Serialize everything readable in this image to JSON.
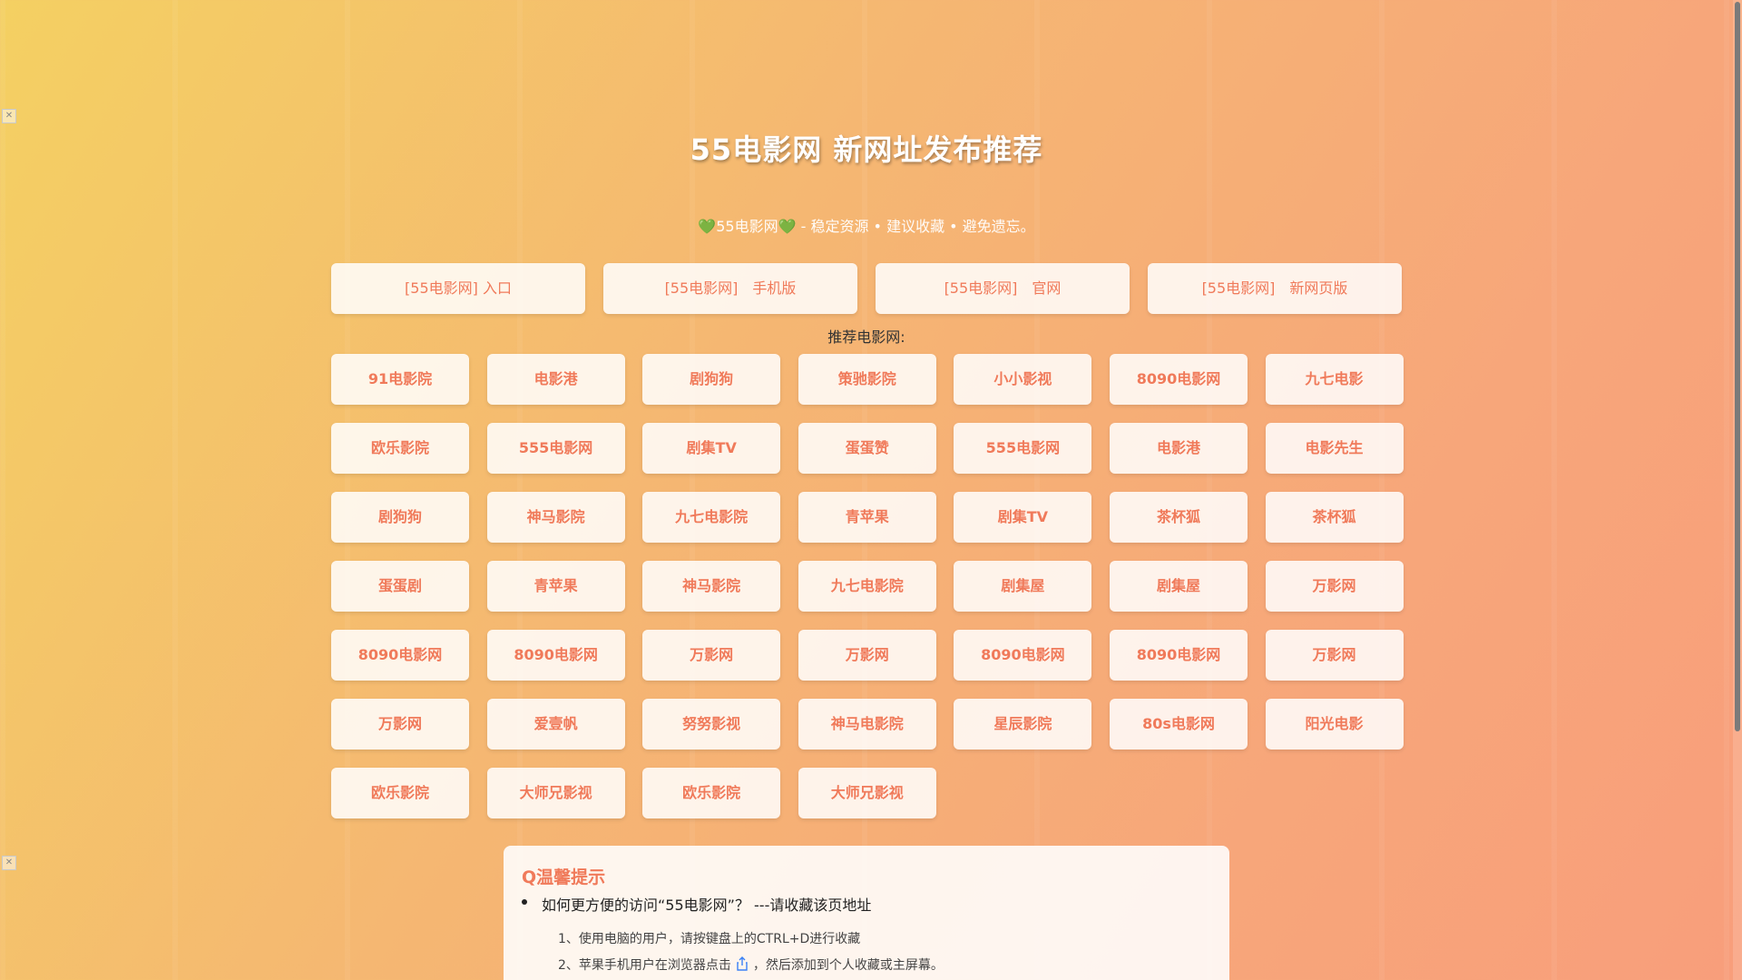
{
  "page": {
    "title": "55电影网 新网址发布推荐",
    "subtitle": {
      "heart_left": "💚",
      "text": "55电影网",
      "heart_right": "💚",
      "tagline": " - 稳定资源 • 建议收藏 • 避免遗忘。"
    }
  },
  "top_links": [
    {
      "label": "[55电影网] 入口"
    },
    {
      "label": "[55电影网]　手机版"
    },
    {
      "label": "[55电影网]　官网"
    },
    {
      "label": "[55电影网]　新网页版"
    }
  ],
  "recommend": {
    "label": "推荐电影网:",
    "items": [
      "91电影院",
      "电影港",
      "剧狗狗",
      "策驰影院",
      "小小影视",
      "8090电影网",
      "九七电影",
      "欧乐影院",
      "555电影网",
      "剧集TV",
      "蛋蛋赞",
      "555电影网",
      "电影港",
      "电影先生",
      "剧狗狗",
      "神马影院",
      "九七电影院",
      "青苹果",
      "剧集TV",
      "茶杯狐",
      "茶杯狐",
      "蛋蛋剧",
      "青苹果",
      "神马影院",
      "九七电影院",
      "剧集屋",
      "剧集屋",
      "万影网",
      "8090电影网",
      "8090电影网",
      "万影网",
      "万影网",
      "8090电影网",
      "8090电影网",
      "万影网",
      "万影网",
      "爱壹帆",
      "努努影视",
      "神马电影院",
      "星辰影院",
      "80s电影网",
      "阳光电影",
      "欧乐影院",
      "大师兄影视",
      "欧乐影院",
      "大师兄影视"
    ]
  },
  "tips": {
    "title": "Q温馨提示",
    "question": "如何更方便的访问“55电影网”？ ---请收藏该页地址",
    "step1": "1、使用电脑的用户，请按键盘上的CTRL+D进行收藏",
    "step2_before": "2、苹果手机用户在浏览器点击",
    "step2_icon": "share-icon",
    "step2_after": "，然后添加到个人收藏或主屏幕。"
  },
  "colors": {
    "accent": "#f07a5a",
    "heart": "#46b24b"
  }
}
